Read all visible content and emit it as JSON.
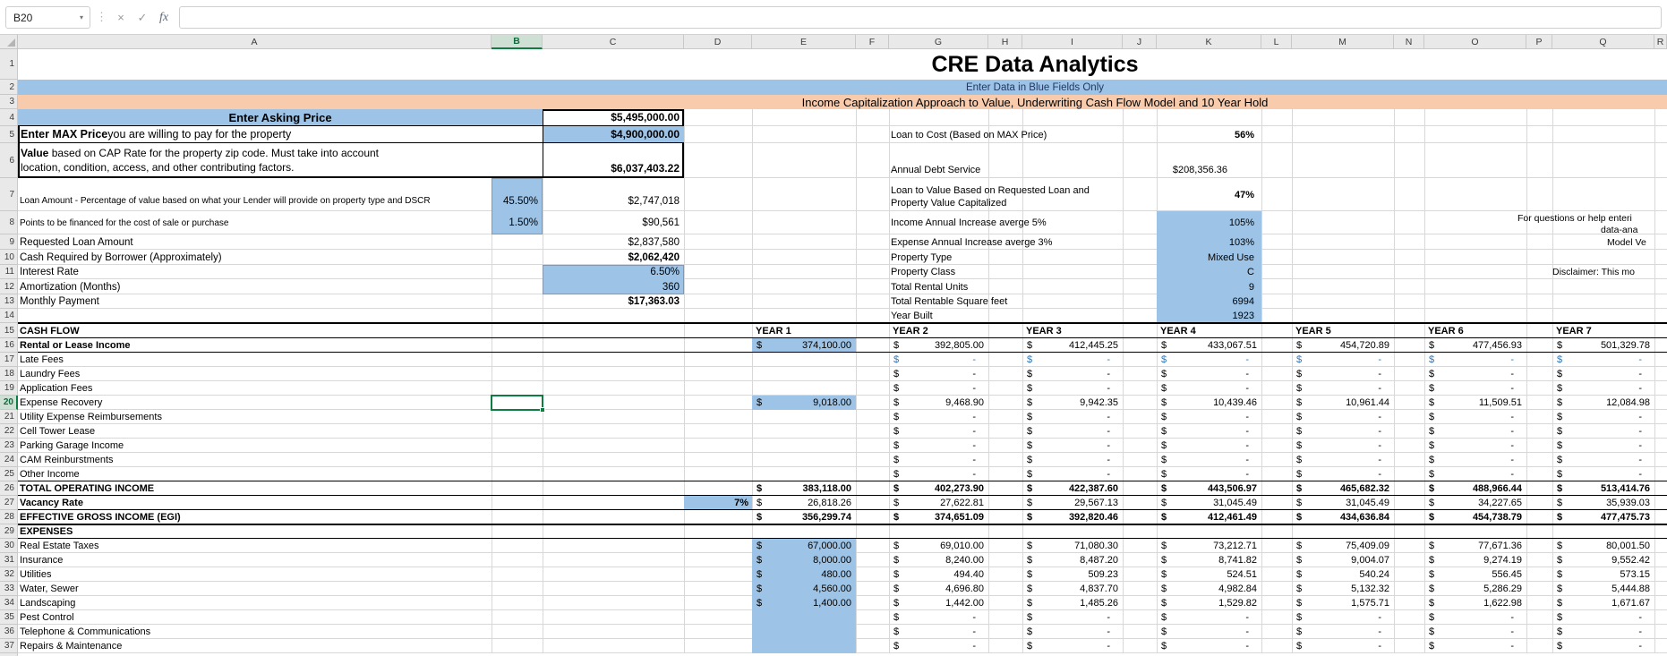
{
  "toolbar": {
    "name_box": "B20",
    "cancel_label": "×",
    "accept_label": "✓",
    "fx_label": "fx",
    "formula_value": ""
  },
  "grid": {
    "columns": [
      "A",
      "B",
      "C",
      "D",
      "E",
      "F",
      "G",
      "H",
      "I",
      "J",
      "K",
      "L",
      "M",
      "N",
      "O",
      "P",
      "Q",
      "R"
    ],
    "first_row": 1,
    "last_row": 37,
    "selected_cell": "B20",
    "selected_column": "B",
    "selected_row": 20
  },
  "header": {
    "title": "CRE Data Analytics",
    "blue_banner": "Enter Data in Blue Fields Only",
    "peach_banner": "Income Capitalization Approach to Value, Underwriting Cash Flow Model and 10 Year Hold"
  },
  "pricing": {
    "asking_label": "Enter Asking Price",
    "asking_value": "$5,495,000.00",
    "max_label_strong": "Enter MAX Price",
    "max_label_rest": " you are willing to pay for the property",
    "max_value": "$4,900,000.00",
    "value_label_strong": "Value",
    "value_label_rest": " based on CAP Rate for the property zip code. Must take into account\nlocation, condition, access, and other contributing factors.",
    "value_value": "$6,037,403.22"
  },
  "loan": [
    {
      "label": "Loan Amount - Percentage of value based on what your Lender will provide on property type and DSCR",
      "pct": "45.50%",
      "amount": "$2,747,018"
    },
    {
      "label": "Points to be financed for the cost of sale or purchase",
      "pct": "1.50%",
      "amount": "$90,561"
    },
    {
      "label": "Requested Loan Amount",
      "amount": "$2,837,580"
    },
    {
      "label": "Cash Required by Borrower (Approximately)",
      "amount": "$2,062,420"
    },
    {
      "label": "Interest Rate",
      "amount": "6.50%"
    },
    {
      "label": "Amortization (Months)",
      "amount": "360"
    },
    {
      "label": "Monthly Payment",
      "amount": "$17,363.03"
    }
  ],
  "summary": [
    {
      "label": "Loan to Cost (Based on MAX Price)",
      "value": "56%"
    },
    {
      "label": "Annual Debt Service",
      "value": "$208,356.36"
    },
    {
      "label": "Loan to Value Based on Requested Loan and\nProperty Value Capitalized",
      "value": "47%"
    },
    {
      "label": "Income Annual Increase averge 5%",
      "value": "105%"
    },
    {
      "label": "Expense Annual Increase averge 3%",
      "value": "103%"
    },
    {
      "label": "Property Type",
      "value": "Mixed Use"
    },
    {
      "label": "Property Class",
      "value": "C"
    },
    {
      "label": "Total Rental Units",
      "value": "9"
    },
    {
      "label": "Total Rentable Square feet",
      "value": "6994"
    },
    {
      "label": "Year Built",
      "value": "1923"
    }
  ],
  "notes": {
    "help_line1": "For questions or help enteri",
    "help_line2": "data-ana",
    "model_version": "Model Ve",
    "disclaimer": "Disclaimer: This mo"
  },
  "cash_flow": {
    "section_label": "CASH FLOW",
    "years": [
      "YEAR 1",
      "YEAR 2",
      "YEAR 3",
      "YEAR 4",
      "YEAR 5",
      "YEAR 6",
      "YEAR 7"
    ],
    "rows": [
      {
        "row": 16,
        "label": "Rental or Lease Income",
        "style": "bold-label",
        "y1": "374,100.00",
        "y1_blue_fill": true,
        "values": [
          "392,805.00",
          "412,445.25",
          "433,067.51",
          "454,720.89",
          "477,456.93",
          "501,329.78"
        ]
      },
      {
        "row": 17,
        "label": "Late Fees",
        "zero": true,
        "blue_text": true
      },
      {
        "row": 18,
        "label": "Laundry Fees",
        "zero": true
      },
      {
        "row": 19,
        "label": "Application Fees",
        "zero": true
      },
      {
        "row": 20,
        "label": "Expense Recovery",
        "y1": "9,018.00",
        "y1_blue_fill": true,
        "values": [
          "9,468.90",
          "9,942.35",
          "10,439.46",
          "10,961.44",
          "11,509.51",
          "12,084.98"
        ]
      },
      {
        "row": 21,
        "label": "Utility Expense Reimbursements",
        "zero": true
      },
      {
        "row": 22,
        "label": "Cell Tower Lease",
        "zero": true
      },
      {
        "row": 23,
        "label": "Parking Garage Income",
        "zero": true
      },
      {
        "row": 24,
        "label": "CAM Reinburstments",
        "zero": true
      },
      {
        "row": 25,
        "label": "Other Income",
        "zero": true
      },
      {
        "row": 26,
        "label": "TOTAL OPERATING INCOME",
        "style": "total",
        "y1": "383,118.00",
        "values": [
          "402,273.90",
          "422,387.60",
          "443,506.97",
          "465,682.32",
          "488,966.44",
          "513,414.76"
        ]
      },
      {
        "row": 27,
        "label": "Vacancy Rate",
        "style": "bold-label",
        "rate": "7%",
        "y1": "26,818.26",
        "values": [
          "27,622.81",
          "29,567.13",
          "31,045.49",
          "31,045.49",
          "34,227.65",
          "35,939.03"
        ]
      },
      {
        "row": 28,
        "label": "EFFECTIVE GROSS INCOME (EGI)",
        "style": "total",
        "y1": "356,299.74",
        "values": [
          "374,651.09",
          "392,820.46",
          "412,461.49",
          "434,636.84",
          "454,738.79",
          "477,475.73"
        ]
      }
    ],
    "expenses_label": "EXPENSES",
    "expense_rows": [
      {
        "row": 30,
        "label": "Real Estate Taxes",
        "y1": "67,000.00",
        "y1_blue_fill": true,
        "values": [
          "69,010.00",
          "71,080.30",
          "73,212.71",
          "75,409.09",
          "77,671.36",
          "80,001.50"
        ]
      },
      {
        "row": 31,
        "label": "Insurance",
        "y1": "8,000.00",
        "y1_blue_fill": true,
        "values": [
          "8,240.00",
          "8,487.20",
          "8,741.82",
          "9,004.07",
          "9,274.19",
          "9,552.42"
        ]
      },
      {
        "row": 32,
        "label": "Utilities",
        "y1": "480.00",
        "y1_blue_fill": true,
        "values": [
          "494.40",
          "509.23",
          "524.51",
          "540.24",
          "556.45",
          "573.15"
        ]
      },
      {
        "row": 33,
        "label": "Water, Sewer",
        "y1": "4,560.00",
        "y1_blue_fill": true,
        "values": [
          "4,696.80",
          "4,837.70",
          "4,982.84",
          "5,132.32",
          "5,286.29",
          "5,444.88"
        ]
      },
      {
        "row": 34,
        "label": "Landscaping",
        "y1": "1,400.00",
        "y1_blue_fill": true,
        "values": [
          "1,442.00",
          "1,485.26",
          "1,529.82",
          "1,575.71",
          "1,622.98",
          "1,671.67"
        ]
      },
      {
        "row": 35,
        "label": "Pest Control",
        "zero": true,
        "y1_blue_fill": true
      },
      {
        "row": 36,
        "label": "Telephone & Communications",
        "zero": true,
        "y1_blue_fill": true
      },
      {
        "row": 37,
        "label": "Repairs & Maintenance",
        "zero": true,
        "y1_blue_fill": true
      }
    ]
  }
}
